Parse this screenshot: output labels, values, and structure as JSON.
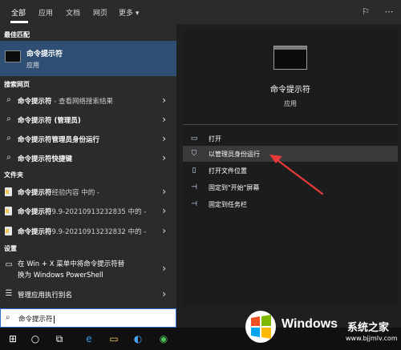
{
  "tabs": [
    {
      "label": "全部"
    },
    {
      "label": "应用"
    },
    {
      "label": "文档"
    },
    {
      "label": "网页"
    },
    {
      "label": "更多 ▾"
    }
  ],
  "best_match": {
    "section": "最佳匹配",
    "title": "命令提示符",
    "subtitle": "应用"
  },
  "web": {
    "section": "搜索网页",
    "items": [
      {
        "bold": "命令提示符",
        "rest": " - 查看网络搜索结果"
      },
      {
        "bold": "命令提示符 (管理员)",
        "rest": ""
      },
      {
        "bold": "命令提示符管理员身份运行",
        "rest": ""
      },
      {
        "bold": "命令提示符快捷键",
        "rest": ""
      }
    ]
  },
  "files": {
    "section": "文件夹",
    "items": [
      {
        "bold": "命令提示符",
        "rest": "经验内容 中的 -"
      },
      {
        "bold": "命令提示符",
        "rest": "9.9-20210913232835 中的 -"
      },
      {
        "bold": "命令提示符",
        "rest": "9.9-20210913232832 中的 -"
      }
    ]
  },
  "settings": {
    "section": "设置",
    "items": [
      {
        "line1": "在 Win + X 菜单中将命令提示符替",
        "line2": "换为 Windows PowerShell"
      },
      {
        "line1": "管理应用执行别名",
        "line2": ""
      }
    ]
  },
  "preview": {
    "title": "命令提示符",
    "subtitle": "应用",
    "actions": [
      {
        "label": "打开",
        "icon": "open-icon"
      },
      {
        "label": "以管理员身份运行",
        "icon": "shield-icon"
      },
      {
        "label": "打开文件位置",
        "icon": "file-location-icon"
      },
      {
        "label": "固定到\"开始\"屏幕",
        "icon": "pin-icon"
      },
      {
        "label": "固定到任务栏",
        "icon": "pin-icon"
      }
    ]
  },
  "search": {
    "value": "命令提示符"
  },
  "watermark": {
    "brand": "Windows",
    "cn": "系统之家",
    "url": "www.bjjmlv.com"
  },
  "colors": {
    "selected": "#2f4e73",
    "accent": "#2f6fd1",
    "arrow": "#e83a3a"
  }
}
